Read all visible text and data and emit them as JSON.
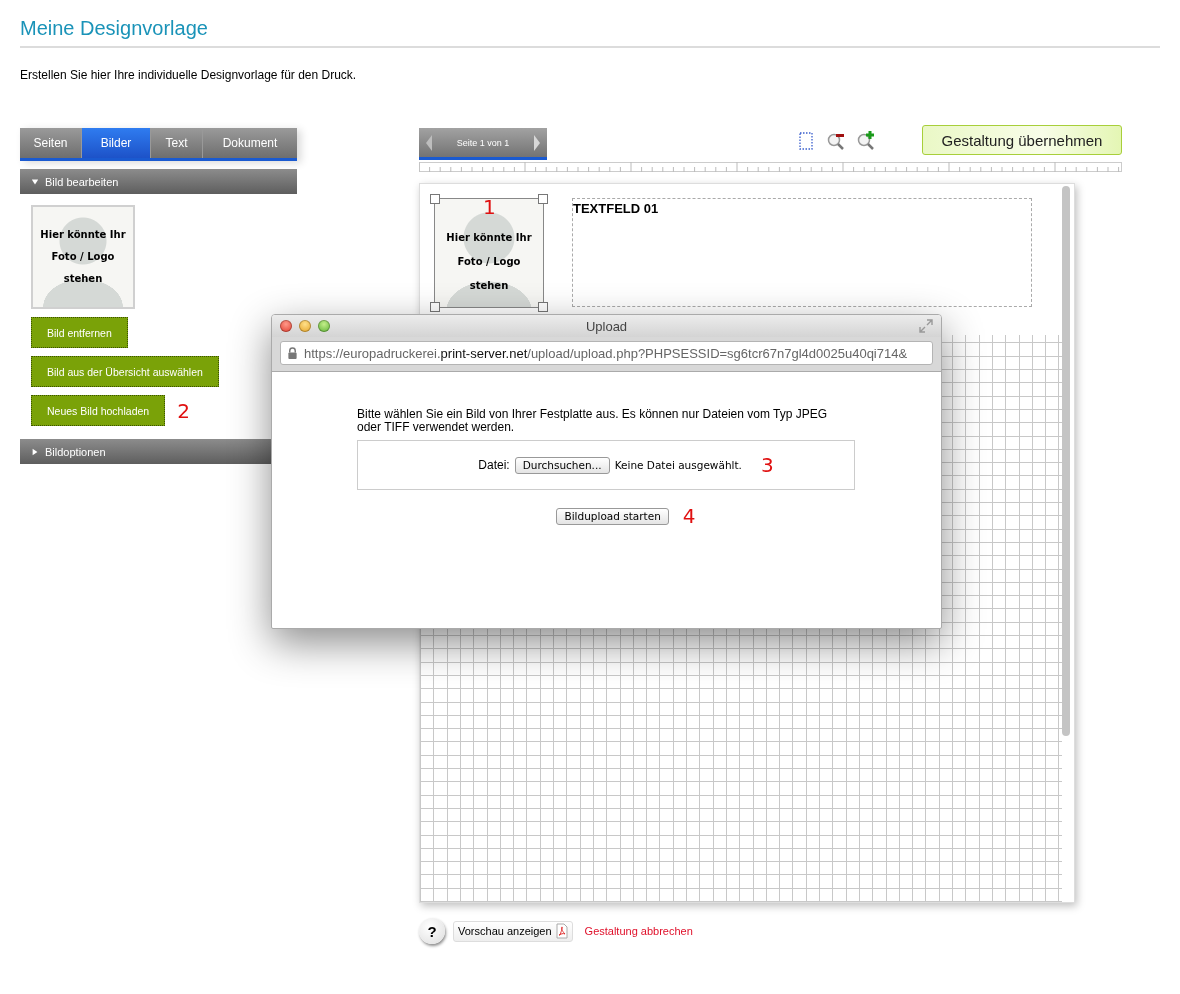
{
  "page": {
    "title": "Meine Designvorlage",
    "intro": "Erstellen Sie hier Ihre individuelle Designvorlage für den Druck."
  },
  "tabs": [
    {
      "label": "Seiten",
      "selected": false
    },
    {
      "label": "Bilder",
      "selected": true
    },
    {
      "label": "Text",
      "selected": false
    },
    {
      "label": "Dokument",
      "selected": false
    }
  ],
  "sections": [
    {
      "title": "Bild bearbeiten",
      "expanded": true
    },
    {
      "title": "Bildoptionen",
      "expanded": false
    }
  ],
  "image_placeholder": {
    "text": "Hier könnte Ihr\nFoto / Logo\nstehen"
  },
  "image_buttons": [
    {
      "label": "Bild entfernen"
    },
    {
      "label": "Bild aus der Übersicht auswählen"
    },
    {
      "label": "Neues Bild hochladen",
      "annotation": "2"
    }
  ],
  "pager": {
    "label": "Seite 1 von 1"
  },
  "apply_button": "Gestaltung übernehmen",
  "canvas": {
    "image_annotation": "1",
    "image_text": "Hier könnte Ihr\nFoto / Logo\nstehen",
    "textfield": "TEXTFELD 01"
  },
  "dialog": {
    "title": "Upload",
    "url_prefix": "https://europadruckerei.",
    "url_domain": "print-server.net",
    "url_path": "/upload/upload.php?PHPSESSID=sg6tcr67n7gl4d0025u40qi714&",
    "instructions": "Bitte wählen Sie ein Bild von Ihrer Festplatte aus. Es können nur Dateien vom Typ JPEG oder TIFF verwendet werden.",
    "file_label": "Datei:",
    "browse_button": "Durchsuchen...",
    "file_status": "Keine Datei ausgewählt.",
    "file_annotation": "3",
    "upload_button": "Bildupload starten",
    "upload_annotation": "4"
  },
  "footer": {
    "help": "?",
    "preview_button": "Vorschau anzeigen",
    "cancel_link": "Gestaltung abbrechen"
  }
}
